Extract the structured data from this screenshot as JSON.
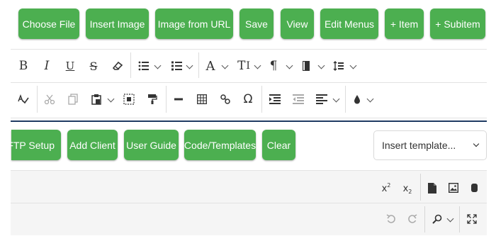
{
  "top_buttons": {
    "choose_file": "Choose File",
    "insert_image": "Insert Image",
    "image_from_url": "Image from URL",
    "save": "Save",
    "view": "View",
    "edit_menus": "Edit Menus",
    "add_item": "+ Item",
    "add_subitem": "+ Subitem"
  },
  "toolbar_row1": {
    "bold": "B",
    "italic": "I",
    "underline": "U",
    "strikethrough": "S",
    "font_size": "A",
    "text_style": "T",
    "paragraph": "¶"
  },
  "toolbar_row2": {
    "omega": "Ω"
  },
  "action_buttons": {
    "ftp_setup": "FTP Setup",
    "add_client": "Add Client",
    "user_guide": "User Guide",
    "code_templates": "Code/Templates",
    "clear": "Clear"
  },
  "template_select": {
    "selected": "Insert template..."
  },
  "editor_toolbar": {
    "superscript_base": "x",
    "superscript_exp": "2",
    "subscript_base": "x",
    "subscript_exp": "2"
  },
  "colors": {
    "button_green": "#4caf50",
    "toolbar_bg": "#f5f5f5",
    "divider_blue": "#1f3b63"
  }
}
